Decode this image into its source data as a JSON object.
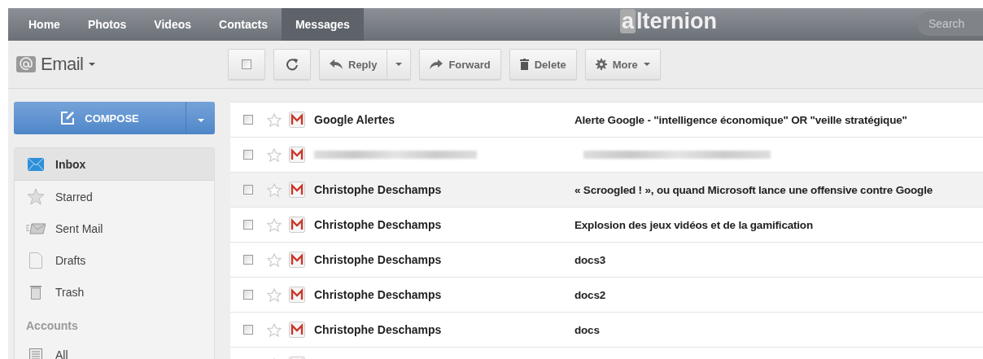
{
  "nav": {
    "tabs": [
      {
        "label": "Home",
        "selected": false
      },
      {
        "label": "Photos",
        "selected": false
      },
      {
        "label": "Videos",
        "selected": false
      },
      {
        "label": "Contacts",
        "selected": false
      },
      {
        "label": "Messages",
        "selected": true
      }
    ],
    "logo": {
      "mark": "a",
      "rest": "lternion"
    },
    "search": {
      "placeholder": "Search"
    }
  },
  "app_title": "Email",
  "toolbar": [
    {
      "kind": "checkbox",
      "checked": false
    },
    {
      "kind": "refresh"
    },
    {
      "kind": "reply",
      "label": "Reply"
    },
    {
      "kind": "forward",
      "label": "Forward"
    },
    {
      "kind": "delete",
      "label": "Delete"
    },
    {
      "kind": "more",
      "label": "More"
    }
  ],
  "compose": {
    "label": "COMPOSE"
  },
  "sidebar": {
    "items": [
      {
        "label": "Inbox",
        "selected": true
      },
      {
        "label": "Starred",
        "selected": false
      },
      {
        "label": "Sent Mail",
        "selected": false
      },
      {
        "label": "Drafts",
        "selected": false
      },
      {
        "label": "Trash",
        "selected": false
      }
    ],
    "accounts_heading": "Accounts",
    "accounts": [
      {
        "label": "All",
        "selected": false
      }
    ]
  },
  "messages": [
    {
      "kind": "mail",
      "checked": false,
      "starred": false,
      "highlighted": false,
      "sender": "Google Alertes",
      "subject": "Alerte Google - \"intelligence économique\" OR \"veille stratégique\""
    },
    {
      "kind": "blurred",
      "checked": false,
      "starred": false,
      "highlighted": false
    },
    {
      "kind": "mail",
      "checked": false,
      "starred": false,
      "highlighted": true,
      "sender": "Christophe Deschamps",
      "subject": "« Scroogled ! », ou quand Microsoft lance une offensive contre Google"
    },
    {
      "kind": "mail",
      "checked": false,
      "starred": false,
      "highlighted": false,
      "sender": "Christophe Deschamps",
      "subject": "Explosion des jeux vidéos et de la gamification"
    },
    {
      "kind": "mail",
      "checked": false,
      "starred": false,
      "highlighted": false,
      "sender": "Christophe Deschamps",
      "subject": "docs3"
    },
    {
      "kind": "mail",
      "checked": false,
      "starred": false,
      "highlighted": false,
      "sender": "Christophe Deschamps",
      "subject": "docs2"
    },
    {
      "kind": "mail",
      "checked": false,
      "starred": false,
      "highlighted": false,
      "sender": "Christophe Deschamps",
      "subject": "docs"
    },
    {
      "kind": "cut"
    }
  ]
}
